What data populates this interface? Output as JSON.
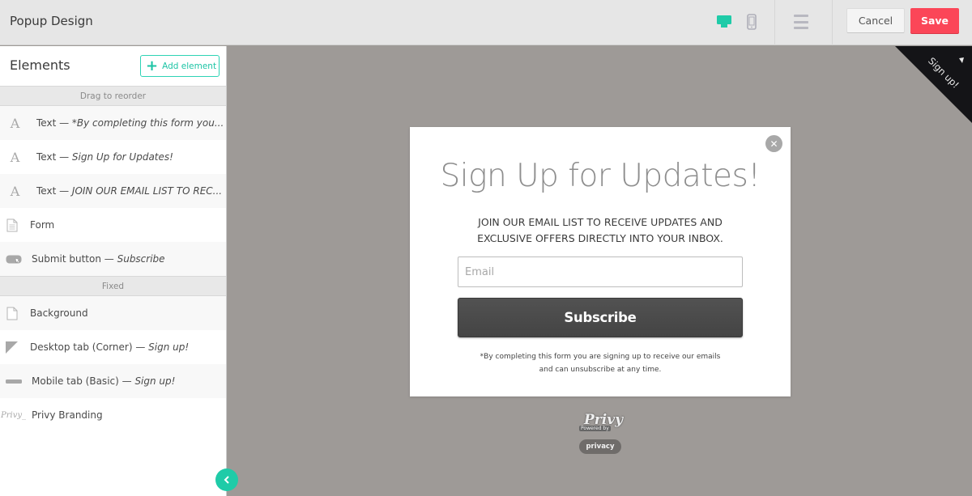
{
  "app": {
    "title": "Popup Design"
  },
  "toolbar": {
    "devices": [
      {
        "name": "desktop",
        "icon": "desktop-icon",
        "active": true
      },
      {
        "name": "mobile",
        "icon": "mobile-icon",
        "active": false
      }
    ],
    "menu_icon": "hamburger-menu-icon",
    "cancel_label": "Cancel",
    "save_label": "Save"
  },
  "colors": {
    "accent": "#1fcba8",
    "save": "#fb4658",
    "canvas_bg": "#9e9a97",
    "button_dark": "#4a4a4a"
  },
  "sidebar": {
    "title": "Elements",
    "add_button_label": "Add element",
    "sections": [
      {
        "label": "Drag to reorder",
        "items": [
          {
            "icon": "text-icon",
            "label": "Text — ",
            "detail": "*By completing this form you..."
          },
          {
            "icon": "text-icon",
            "label": "Text — ",
            "detail": "Sign Up for Updates!"
          },
          {
            "icon": "text-icon",
            "label": "Text — ",
            "detail": "JOIN OUR EMAIL LIST TO REC..."
          },
          {
            "icon": "form-icon",
            "label": "Form",
            "detail": ""
          },
          {
            "icon": "submit-button-icon",
            "label": "Submit button — ",
            "detail": "Subscribe"
          }
        ]
      },
      {
        "label": "Fixed",
        "items": [
          {
            "icon": "background-page-icon",
            "label": "Background",
            "detail": ""
          },
          {
            "icon": "corner-tab-icon",
            "label": "Desktop tab (Corner) — ",
            "detail": "Sign up!"
          },
          {
            "icon": "mobile-tab-icon",
            "label": "Mobile tab (Basic) — ",
            "detail": "Sign up!"
          },
          {
            "icon": "privy-logo-icon",
            "label": "Privy Branding",
            "detail": ""
          }
        ]
      }
    ],
    "collapse_icon": "chevron-left-icon"
  },
  "canvas": {
    "corner_tab_text": "Sign up!",
    "popup": {
      "headline": "Sign Up for Updates!",
      "subhead_line1": "JOIN OUR EMAIL LIST TO RECEIVE UPDATES AND",
      "subhead_line2": "EXCLUSIVE OFFERS DIRECTLY INTO YOUR INBOX.",
      "email_placeholder": "Email",
      "email_value": "",
      "subscribe_label": "Subscribe",
      "disclaimer_line1": "*By completing this form you are signing up to receive our emails",
      "disclaimer_line2": "and can unsubscribe at any time.",
      "close_icon": "close-icon"
    },
    "branding": {
      "logo_text": "Privy",
      "powered_by": "Powered by",
      "privacy_label": "privacy"
    }
  }
}
